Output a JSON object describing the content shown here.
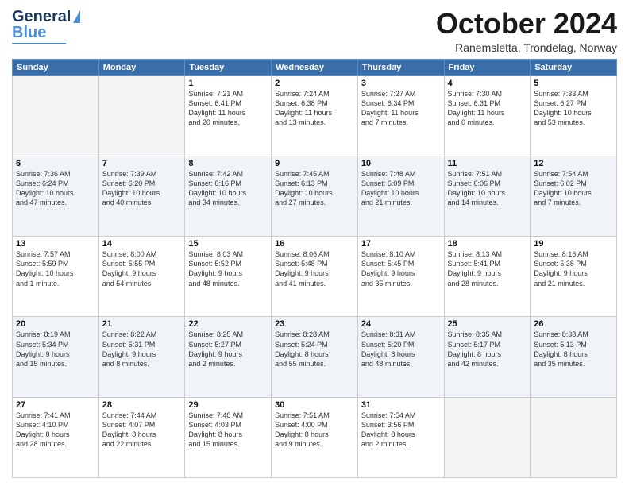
{
  "header": {
    "logo_general": "General",
    "logo_blue": "Blue",
    "month": "October 2024",
    "location": "Ranemsletta, Trondelag, Norway"
  },
  "days_of_week": [
    "Sunday",
    "Monday",
    "Tuesday",
    "Wednesday",
    "Thursday",
    "Friday",
    "Saturday"
  ],
  "weeks": [
    [
      {
        "num": "",
        "info": ""
      },
      {
        "num": "",
        "info": ""
      },
      {
        "num": "1",
        "info": "Sunrise: 7:21 AM\nSunset: 6:41 PM\nDaylight: 11 hours\nand 20 minutes."
      },
      {
        "num": "2",
        "info": "Sunrise: 7:24 AM\nSunset: 6:38 PM\nDaylight: 11 hours\nand 13 minutes."
      },
      {
        "num": "3",
        "info": "Sunrise: 7:27 AM\nSunset: 6:34 PM\nDaylight: 11 hours\nand 7 minutes."
      },
      {
        "num": "4",
        "info": "Sunrise: 7:30 AM\nSunset: 6:31 PM\nDaylight: 11 hours\nand 0 minutes."
      },
      {
        "num": "5",
        "info": "Sunrise: 7:33 AM\nSunset: 6:27 PM\nDaylight: 10 hours\nand 53 minutes."
      }
    ],
    [
      {
        "num": "6",
        "info": "Sunrise: 7:36 AM\nSunset: 6:24 PM\nDaylight: 10 hours\nand 47 minutes."
      },
      {
        "num": "7",
        "info": "Sunrise: 7:39 AM\nSunset: 6:20 PM\nDaylight: 10 hours\nand 40 minutes."
      },
      {
        "num": "8",
        "info": "Sunrise: 7:42 AM\nSunset: 6:16 PM\nDaylight: 10 hours\nand 34 minutes."
      },
      {
        "num": "9",
        "info": "Sunrise: 7:45 AM\nSunset: 6:13 PM\nDaylight: 10 hours\nand 27 minutes."
      },
      {
        "num": "10",
        "info": "Sunrise: 7:48 AM\nSunset: 6:09 PM\nDaylight: 10 hours\nand 21 minutes."
      },
      {
        "num": "11",
        "info": "Sunrise: 7:51 AM\nSunset: 6:06 PM\nDaylight: 10 hours\nand 14 minutes."
      },
      {
        "num": "12",
        "info": "Sunrise: 7:54 AM\nSunset: 6:02 PM\nDaylight: 10 hours\nand 7 minutes."
      }
    ],
    [
      {
        "num": "13",
        "info": "Sunrise: 7:57 AM\nSunset: 5:59 PM\nDaylight: 10 hours\nand 1 minute."
      },
      {
        "num": "14",
        "info": "Sunrise: 8:00 AM\nSunset: 5:55 PM\nDaylight: 9 hours\nand 54 minutes."
      },
      {
        "num": "15",
        "info": "Sunrise: 8:03 AM\nSunset: 5:52 PM\nDaylight: 9 hours\nand 48 minutes."
      },
      {
        "num": "16",
        "info": "Sunrise: 8:06 AM\nSunset: 5:48 PM\nDaylight: 9 hours\nand 41 minutes."
      },
      {
        "num": "17",
        "info": "Sunrise: 8:10 AM\nSunset: 5:45 PM\nDaylight: 9 hours\nand 35 minutes."
      },
      {
        "num": "18",
        "info": "Sunrise: 8:13 AM\nSunset: 5:41 PM\nDaylight: 9 hours\nand 28 minutes."
      },
      {
        "num": "19",
        "info": "Sunrise: 8:16 AM\nSunset: 5:38 PM\nDaylight: 9 hours\nand 21 minutes."
      }
    ],
    [
      {
        "num": "20",
        "info": "Sunrise: 8:19 AM\nSunset: 5:34 PM\nDaylight: 9 hours\nand 15 minutes."
      },
      {
        "num": "21",
        "info": "Sunrise: 8:22 AM\nSunset: 5:31 PM\nDaylight: 9 hours\nand 8 minutes."
      },
      {
        "num": "22",
        "info": "Sunrise: 8:25 AM\nSunset: 5:27 PM\nDaylight: 9 hours\nand 2 minutes."
      },
      {
        "num": "23",
        "info": "Sunrise: 8:28 AM\nSunset: 5:24 PM\nDaylight: 8 hours\nand 55 minutes."
      },
      {
        "num": "24",
        "info": "Sunrise: 8:31 AM\nSunset: 5:20 PM\nDaylight: 8 hours\nand 48 minutes."
      },
      {
        "num": "25",
        "info": "Sunrise: 8:35 AM\nSunset: 5:17 PM\nDaylight: 8 hours\nand 42 minutes."
      },
      {
        "num": "26",
        "info": "Sunrise: 8:38 AM\nSunset: 5:13 PM\nDaylight: 8 hours\nand 35 minutes."
      }
    ],
    [
      {
        "num": "27",
        "info": "Sunrise: 7:41 AM\nSunset: 4:10 PM\nDaylight: 8 hours\nand 28 minutes."
      },
      {
        "num": "28",
        "info": "Sunrise: 7:44 AM\nSunset: 4:07 PM\nDaylight: 8 hours\nand 22 minutes."
      },
      {
        "num": "29",
        "info": "Sunrise: 7:48 AM\nSunset: 4:03 PM\nDaylight: 8 hours\nand 15 minutes."
      },
      {
        "num": "30",
        "info": "Sunrise: 7:51 AM\nSunset: 4:00 PM\nDaylight: 8 hours\nand 9 minutes."
      },
      {
        "num": "31",
        "info": "Sunrise: 7:54 AM\nSunset: 3:56 PM\nDaylight: 8 hours\nand 2 minutes."
      },
      {
        "num": "",
        "info": ""
      },
      {
        "num": "",
        "info": ""
      }
    ]
  ]
}
